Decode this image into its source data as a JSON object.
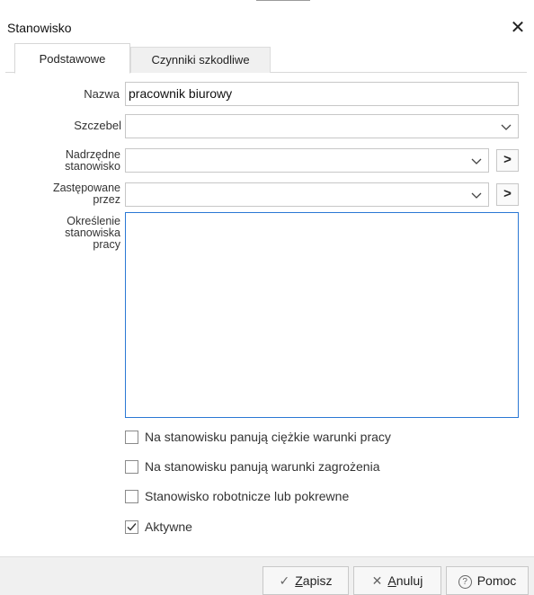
{
  "window": {
    "title": "Stanowisko",
    "close_glyph": "✕"
  },
  "tabs": [
    {
      "label": "Podstawowe",
      "active": true
    },
    {
      "label": "Czynniki szkodliwe",
      "active": false
    }
  ],
  "form": {
    "nazwa_label": "Nazwa",
    "nazwa_value": "pracownik biurowy",
    "szczebel_label": "Szczebel",
    "szczebel_value": "",
    "nadrzedne_label_1": "Nadrzędne",
    "nadrzedne_label_2": "stanowisko",
    "nadrzedne_value": "",
    "zastepowane_label_1": "Zastępowane",
    "zastepowane_label_2": "przez",
    "zastepowane_value": "",
    "okreslenie_label_1": "Określenie",
    "okreslenie_label_2": "stanowiska",
    "okreslenie_label_3": "pracy",
    "okreslenie_value": "",
    "goto_glyph": ">"
  },
  "checkboxes": [
    {
      "label": "Na stanowisku panują ciężkie warunki pracy",
      "checked": false
    },
    {
      "label": "Na stanowisku panują warunki zagrożenia",
      "checked": false
    },
    {
      "label": "Stanowisko robotnicze lub pokrewne",
      "checked": false
    },
    {
      "label": "Aktywne",
      "checked": true
    }
  ],
  "footer": {
    "save_icon": "✓",
    "save_hotkey": "Z",
    "save_rest": "apisz",
    "cancel_icon": "✕",
    "cancel_hotkey": "A",
    "cancel_rest": "nuluj",
    "help_icon": "?",
    "help_label": "Pomoc"
  },
  "colors": {
    "accent": "#2b78d4",
    "footer_bg": "#f0f0f0"
  }
}
